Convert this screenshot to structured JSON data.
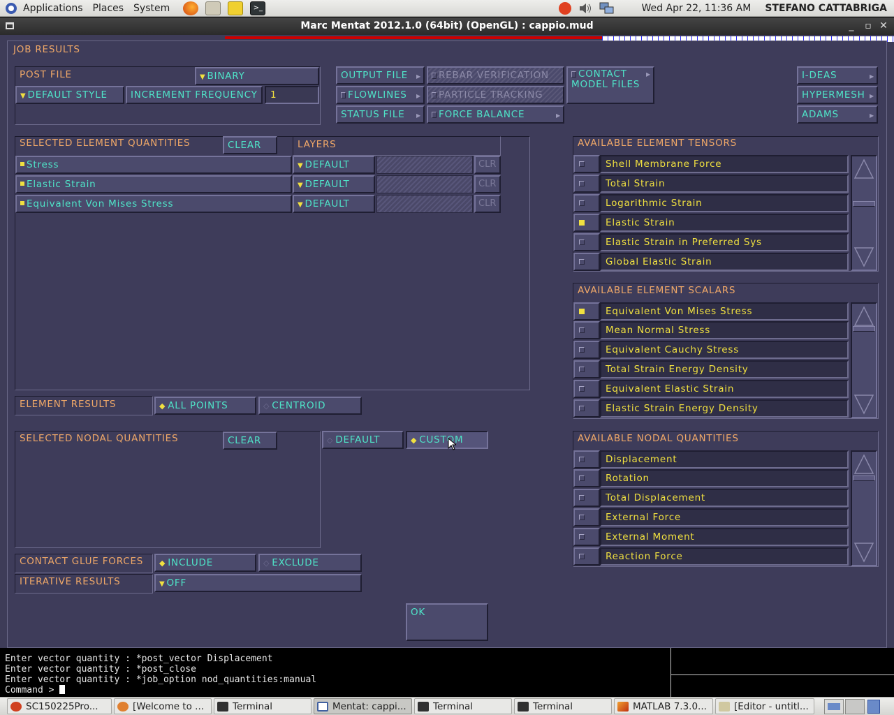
{
  "top_panel": {
    "menus": [
      "Applications",
      "Places",
      "System"
    ],
    "clock": "Wed Apr 22, 11:36 AM",
    "user": "STEFANO CATTABRIGA"
  },
  "window": {
    "title": "Marc Mentat 2012.1.0 (64bit) (OpenGL) : cappio.mud"
  },
  "dialog": {
    "title": "JOB RESULTS",
    "post_file": {
      "label": "POST FILE",
      "format": "BINARY",
      "default_style": "DEFAULT STYLE",
      "increment_frequency_label": "INCREMENT FREQUENCY",
      "increment_frequency_value": "1"
    },
    "file_buttons": {
      "output_file": "OUTPUT FILE",
      "flowlines": "FLOWLINES",
      "status_file": "STATUS FILE",
      "rebar_verification": "REBAR VERIFICATION",
      "particle_tracking": "PARTICLE TRACKING",
      "force_balance": "FORCE BALANCE",
      "contact_model_files": "CONTACT MODEL FILES",
      "ideas": "I-DEAS",
      "hypermesh": "HYPERMESH",
      "adams": "ADAMS"
    },
    "selected_element_quantities": {
      "label": "SELECTED ELEMENT QUANTITIES",
      "clear": "CLEAR",
      "layers_label": "LAYERS",
      "clr": "CLR",
      "items": [
        {
          "name": "Stress",
          "layer": "DEFAULT"
        },
        {
          "name": "Elastic Strain",
          "layer": "DEFAULT"
        },
        {
          "name": "Equivalent Von Mises Stress",
          "layer": "DEFAULT"
        }
      ]
    },
    "element_results": {
      "label": "ELEMENT RESULTS",
      "all_points": "ALL POINTS",
      "centroid": "CENTROID",
      "selected": "ALL POINTS"
    },
    "selected_nodal_quantities": {
      "label": "SELECTED NODAL QUANTITIES",
      "clear": "CLEAR",
      "default": "DEFAULT",
      "custom": "CUSTOM",
      "selected": "CUSTOM"
    },
    "contact_glue_forces": {
      "label": "CONTACT GLUE FORCES",
      "include": "INCLUDE",
      "exclude": "EXCLUDE",
      "selected": "INCLUDE"
    },
    "iterative_results": {
      "label": "ITERATIVE RESULTS",
      "value": "OFF"
    },
    "ok": "OK",
    "available_element_tensors": {
      "label": "AVAILABLE ELEMENT TENSORS",
      "items": [
        {
          "name": "Shell Membrane Force",
          "checked": false
        },
        {
          "name": "Total Strain",
          "checked": false
        },
        {
          "name": "Logarithmic Strain",
          "checked": false
        },
        {
          "name": "Elastic Strain",
          "checked": true
        },
        {
          "name": "Elastic Strain in Preferred Sys",
          "checked": false
        },
        {
          "name": "Global Elastic Strain",
          "checked": false
        }
      ]
    },
    "available_element_scalars": {
      "label": "AVAILABLE ELEMENT SCALARS",
      "items": [
        {
          "name": "Equivalent Von Mises Stress",
          "checked": true
        },
        {
          "name": "Mean Normal Stress",
          "checked": false
        },
        {
          "name": "Equivalent Cauchy Stress",
          "checked": false
        },
        {
          "name": "Total Strain Energy Density",
          "checked": false
        },
        {
          "name": "Equivalent Elastic Strain",
          "checked": false
        },
        {
          "name": "Elastic Strain Energy Density",
          "checked": false
        }
      ]
    },
    "available_nodal_quantities": {
      "label": "AVAILABLE NODAL QUANTITIES",
      "items": [
        {
          "name": "Displacement",
          "checked": false
        },
        {
          "name": "Rotation",
          "checked": false
        },
        {
          "name": "Total Displacement",
          "checked": false
        },
        {
          "name": "External Force",
          "checked": false
        },
        {
          "name": "External Moment",
          "checked": false
        },
        {
          "name": "Reaction Force",
          "checked": false
        }
      ]
    }
  },
  "terminal": {
    "lines": [
      "Enter vector quantity : *post_vector Displacement",
      "Enter vector quantity : *post_close",
      "Enter vector quantity : *job_option nod_quantities:manual"
    ],
    "prompt": "Command > "
  },
  "taskbar": {
    "tasks": [
      {
        "label": "SC150225Pro...",
        "icon_color": "#d04020"
      },
      {
        "label": "[Welcome to ...",
        "icon_color": "#e08030"
      },
      {
        "label": "Terminal",
        "icon_color": "#303030"
      },
      {
        "label": "Mentat: cappi...",
        "icon_color": "#4060a0",
        "active": true
      },
      {
        "label": "Terminal",
        "icon_color": "#303030"
      },
      {
        "label": "Terminal",
        "icon_color": "#303030"
      },
      {
        "label": "MATLAB  7.3.0...",
        "icon_color": "#c04010"
      },
      {
        "label": "[Editor - untitl...",
        "icon_color": "#d0c8a0"
      }
    ]
  },
  "colors": {
    "dialog_bg": "#3e3c5a",
    "label_orange": "#f0a868",
    "button_cyan": "#4fe4c8",
    "value_yellow": "#f0e040"
  }
}
